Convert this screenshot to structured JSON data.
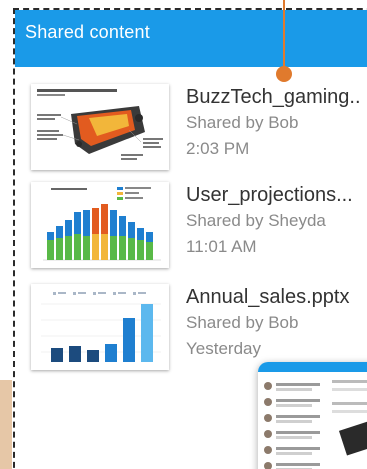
{
  "header": {
    "title": "Shared content"
  },
  "items": [
    {
      "file_name": "BuzzTech_gaming..",
      "shared_by": "Shared by Bob",
      "time": "2:03 PM",
      "thumbnail": "gaming-device-diagram"
    },
    {
      "file_name": "User_projections...",
      "shared_by": "Shared by Sheyda",
      "time": "11:01 AM",
      "thumbnail": "projected-users-chart"
    },
    {
      "file_name": "Annual_sales.pptx",
      "shared_by": "Shared by Bob",
      "time": "Yesterday",
      "thumbnail": "annual-sales-chart"
    }
  ],
  "colors": {
    "header": "#1a9ae8",
    "pointer": "#e07a2d",
    "frame": "#2a2a2a"
  }
}
